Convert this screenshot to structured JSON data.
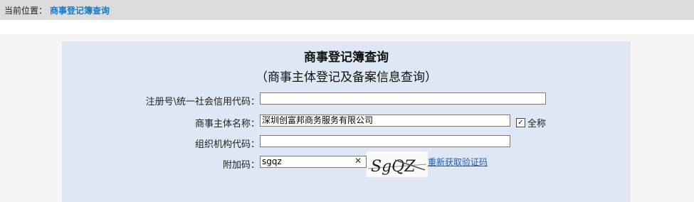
{
  "breadcrumb": {
    "label": "当前位置：",
    "current": "商事登记簿查询"
  },
  "panel": {
    "title": "商事登记簿查询",
    "subtitle": "（商事主体登记及备案信息查询）"
  },
  "form": {
    "reg_no": {
      "label": "注册号\\统一社会信用代码：",
      "value": ""
    },
    "name": {
      "label": "商事主体名称：",
      "value": "深圳创富邦商务服务有限公司",
      "full_name_checked": true,
      "full_name_label": "全称"
    },
    "org_code": {
      "label": "组织机构代码：",
      "value": ""
    },
    "captcha": {
      "label": "附加码：",
      "value": "sgqz",
      "image_text": "SgQZ",
      "refresh_label": "重新获取验证码"
    }
  },
  "icons": {
    "clear": "close-icon",
    "check": "checkmark-icon"
  },
  "colors": {
    "link": "#1a5fb4",
    "breadcrumb": "#1a7bc4",
    "panel_bg": "#dfe6f4"
  }
}
